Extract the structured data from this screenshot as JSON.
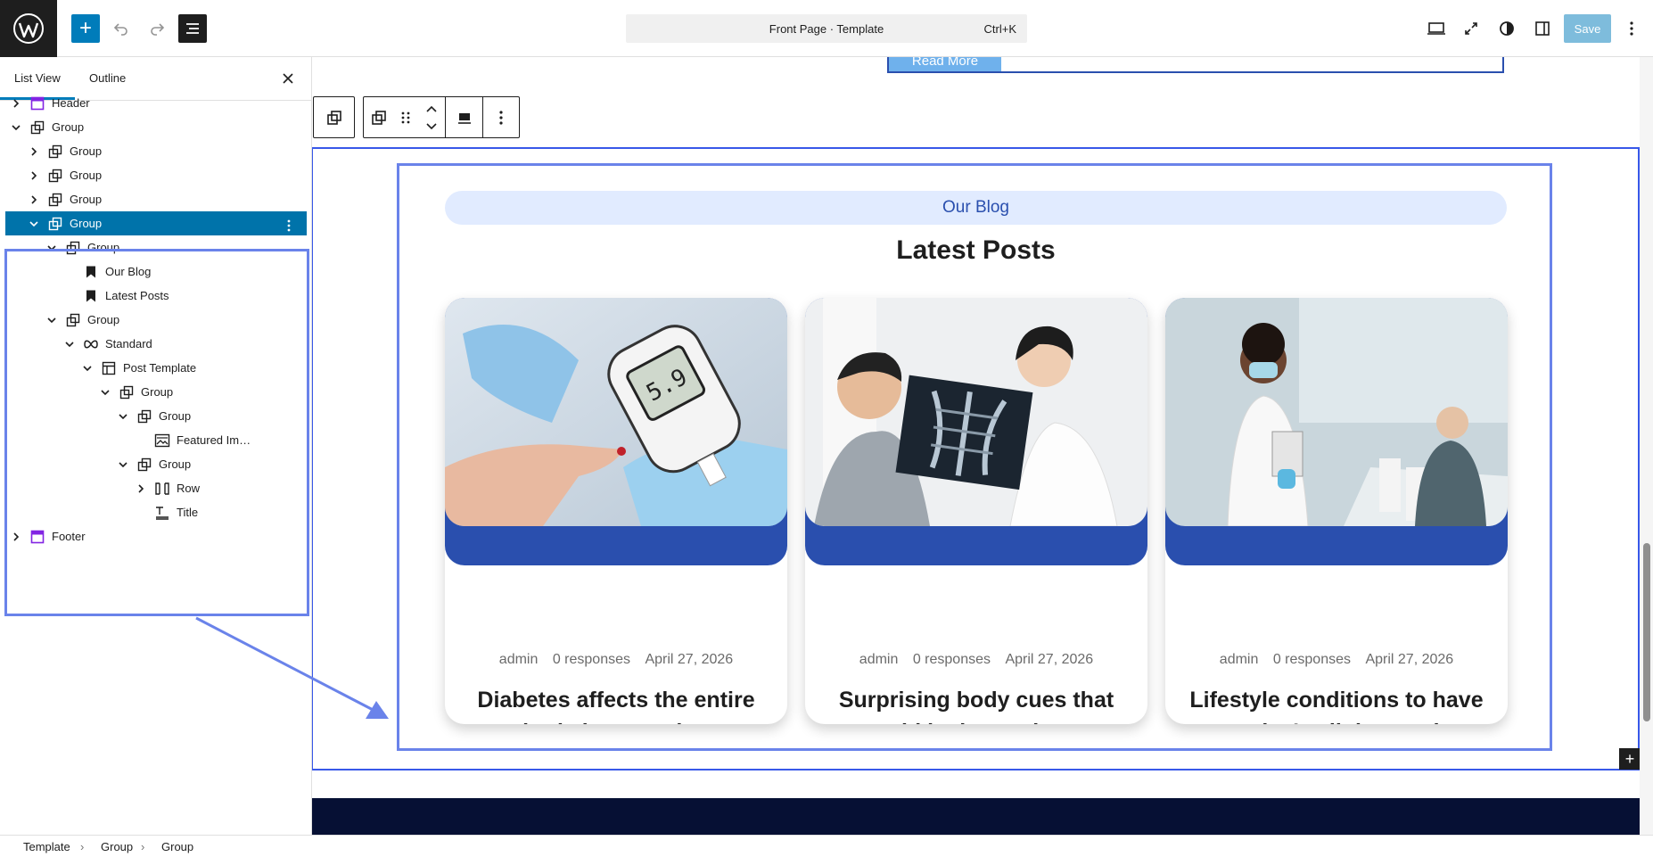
{
  "topbar": {
    "document_title": "Front Page · Template",
    "shortcut": "Ctrl+K",
    "save_label": "Save"
  },
  "sidebar": {
    "tabs": [
      {
        "label": "List View",
        "active": true
      },
      {
        "label": "Outline",
        "active": false
      }
    ],
    "tree": [
      {
        "label": "Header",
        "depth": 0,
        "chevron": "right",
        "icon": "template-part-icon",
        "icon_color": "#8224e3"
      },
      {
        "label": "Group",
        "depth": 0,
        "chevron": "down",
        "icon": "group-icon"
      },
      {
        "label": "Group",
        "depth": 1,
        "chevron": "right",
        "icon": "group-icon"
      },
      {
        "label": "Group",
        "depth": 1,
        "chevron": "right",
        "icon": "group-icon"
      },
      {
        "label": "Group",
        "depth": 1,
        "chevron": "right",
        "icon": "group-icon"
      },
      {
        "label": "Group",
        "depth": 1,
        "chevron": "down",
        "icon": "group-icon",
        "selected": true
      },
      {
        "label": "Group",
        "depth": 2,
        "chevron": "down",
        "icon": "group-icon"
      },
      {
        "label": "Our Blog",
        "depth": 3,
        "chevron": "",
        "icon": "bookmark-icon"
      },
      {
        "label": "Latest Posts",
        "depth": 3,
        "chevron": "",
        "icon": "bookmark-icon"
      },
      {
        "label": "Group",
        "depth": 2,
        "chevron": "down",
        "icon": "group-icon"
      },
      {
        "label": "Standard",
        "depth": 3,
        "chevron": "down",
        "icon": "query-loop-icon"
      },
      {
        "label": "Post Template",
        "depth": 4,
        "chevron": "down",
        "icon": "layout-icon"
      },
      {
        "label": "Group",
        "depth": 5,
        "chevron": "down",
        "icon": "group-icon"
      },
      {
        "label": "Group",
        "depth": 6,
        "chevron": "down",
        "icon": "group-icon"
      },
      {
        "label": "Featured Im…",
        "depth": 7,
        "chevron": "",
        "icon": "image-icon"
      },
      {
        "label": "Group",
        "depth": 6,
        "chevron": "down",
        "icon": "group-icon"
      },
      {
        "label": "Row",
        "depth": 7,
        "chevron": "right",
        "icon": "row-icon"
      },
      {
        "label": "Title",
        "depth": 7,
        "chevron": "",
        "icon": "title-icon"
      },
      {
        "label": "Footer",
        "depth": 0,
        "chevron": "right",
        "icon": "template-part-icon",
        "icon_color": "#8224e3"
      }
    ]
  },
  "canvas": {
    "read_more": "Read More",
    "pill_text": "Our Blog",
    "heading": "Latest Posts",
    "posts": [
      {
        "author": "admin",
        "responses": "0 responses",
        "date": "April 27, 2026",
        "title": "Diabetes affects the entire body in ways that",
        "image": "glucose-meter-photo"
      },
      {
        "author": "admin",
        "responses": "0 responses",
        "date": "April 27, 2026",
        "title": "Surprising body cues that could be heart shown",
        "image": "xray-consultation-photo"
      },
      {
        "author": "admin",
        "responses": "0 responses",
        "date": "April 27, 2026",
        "title": "Lifestyle conditions to have today’s all time and",
        "image": "waiting-room-doctor-photo"
      }
    ]
  },
  "breadcrumb": [
    "Template",
    "Group",
    "Group"
  ],
  "colors": {
    "accent": "#007cba",
    "brand_blue": "#2a4fae",
    "selection": "#0073aa",
    "highlight": "#6a83ea",
    "pill_bg": "#e1ebff",
    "footer_dark": "#061034"
  }
}
